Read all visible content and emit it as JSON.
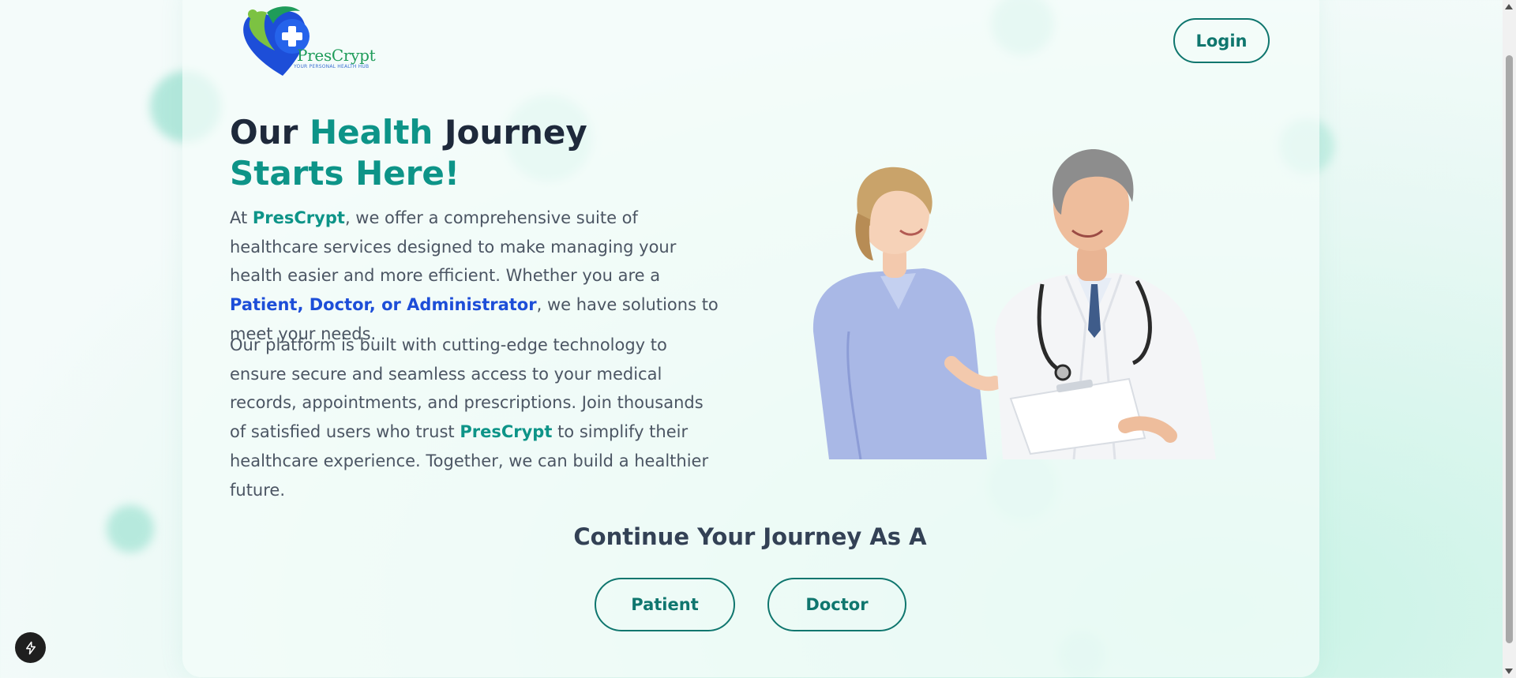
{
  "colors": {
    "brand_teal": "#0d9488",
    "button_teal": "#0f766e",
    "heading_dark": "#1e293b",
    "body_text": "#4b5563",
    "role_blue": "#1d4ed8"
  },
  "logo": {
    "icon": "heart-cross-logo-icon",
    "name": "PresCrypt",
    "tagline": "YOUR PERSONAL HEALTH HUB"
  },
  "header": {
    "login_label": "Login"
  },
  "hero": {
    "title_part1": "Our ",
    "title_part2": "Health",
    "title_part3": " Journey ",
    "title_part4": "Starts Here!",
    "p1_prefix": "At ",
    "p1_brand": "PresCrypt",
    "p1_middle": ", we offer a comprehensive suite of healthcare services designed to make managing your health easier and more efficient. Whether you are a ",
    "p1_roles": "Patient, Doctor, or Administrator",
    "p1_suffix": ", we have solutions to meet your needs.",
    "p2_prefix": "Our platform is built with cutting-edge technology to ensure secure and seamless access to your medical records, appointments, and prescriptions. Join thousands of satisfied users who trust ",
    "p2_brand": "PresCrypt",
    "p2_suffix": " to simplify their healthcare experience. Together, we can build a healthier future.",
    "image": "doctor-and-patient-illustration"
  },
  "continue": {
    "heading": "Continue Your Journey As A",
    "patient_label": "Patient",
    "doctor_label": "Doctor"
  },
  "overlay": {
    "fab_icon": "lightning-bolt-icon"
  }
}
